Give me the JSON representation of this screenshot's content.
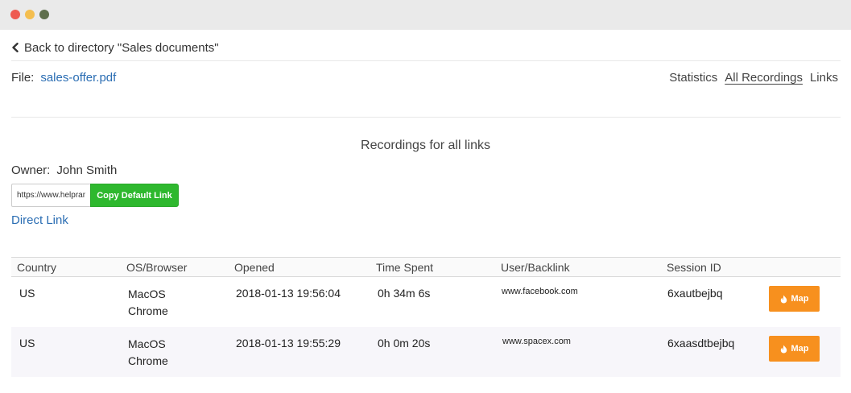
{
  "window": {
    "controls": {
      "close_color": "#ee5b51",
      "minimize_color": "#f4be4f",
      "maximize_color": "#5f6f4c"
    }
  },
  "header": {
    "back_label": "Back to directory \"Sales documents\"",
    "file_label": "File:",
    "file_name": "sales-offer.pdf",
    "nav": [
      {
        "label": "Statistics",
        "active": false
      },
      {
        "label": "All Recordings",
        "active": true
      },
      {
        "label": "Links",
        "active": false
      }
    ]
  },
  "main": {
    "title": "Recordings for all links",
    "owner_label": "Owner:",
    "owner_name": "John Smith",
    "link_value": "https://www.helpran",
    "copy_button_label": "Copy Default Link",
    "direct_link_label": "Direct Link"
  },
  "table": {
    "columns": [
      "Country",
      "OS/Browser",
      "Opened",
      "Time Spent",
      "User/Backlink",
      "Session ID"
    ],
    "rows": [
      {
        "country": "US",
        "os": "MacOS",
        "browser": "Chrome",
        "opened": "2018-01-13 19:56:04",
        "time_spent": "0h 34m 6s",
        "backlink": "www.facebook.com",
        "session_id": "6xautbejbq",
        "map_label": "Map"
      },
      {
        "country": "US",
        "os": "MacOS",
        "browser": "Chrome",
        "opened": "2018-01-13 19:55:29",
        "time_spent": "0h 0m 20s",
        "backlink": "www.spacex.com",
        "session_id": "6xaasdtbejbq",
        "map_label": "Map"
      }
    ]
  },
  "colors": {
    "link": "#2a6db3",
    "copy_button": "#2eb82e",
    "map_button": "#f7901e"
  },
  "icons": {
    "back": "chevron-left-icon",
    "map_button": "fire-icon"
  }
}
